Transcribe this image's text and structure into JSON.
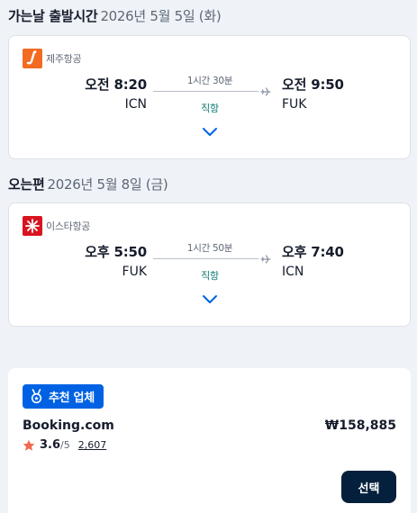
{
  "colors": {
    "accent": "#0062e3",
    "stops_teal": "#0b7b73",
    "button_dark": "#05203c",
    "star": "#ef6a4f"
  },
  "outbound": {
    "label": "가는날 출발시간",
    "date": "2026년 5월 5일 (화)",
    "airline": {
      "name": "제주항공",
      "logo": "jeju-air-logo"
    },
    "departure": {
      "time": "오전 8:20",
      "airport": "ICN"
    },
    "arrival": {
      "time": "오전 9:50",
      "airport": "FUK"
    },
    "duration": "1시간 30분",
    "stops": "직항",
    "expand_icon": "chevron-down-icon"
  },
  "inbound": {
    "label": "오는편",
    "date": "2026년 5월 8일 (금)",
    "airline": {
      "name": "이스타항공",
      "logo": "eastar-jet-logo"
    },
    "departure": {
      "time": "오후 5:50",
      "airport": "FUK"
    },
    "arrival": {
      "time": "오후 7:40",
      "airport": "ICN"
    },
    "duration": "1시간 50분",
    "stops": "직항",
    "expand_icon": "chevron-down-icon"
  },
  "offer": {
    "badge": "추천 업체",
    "badge_icon": "medal-icon",
    "provider": "Booking.com",
    "price": "₩158,885",
    "rating": 3.6,
    "rating_text": "3.6",
    "rating_max": "/5",
    "reviews": "2,607",
    "select_label": "선택"
  }
}
